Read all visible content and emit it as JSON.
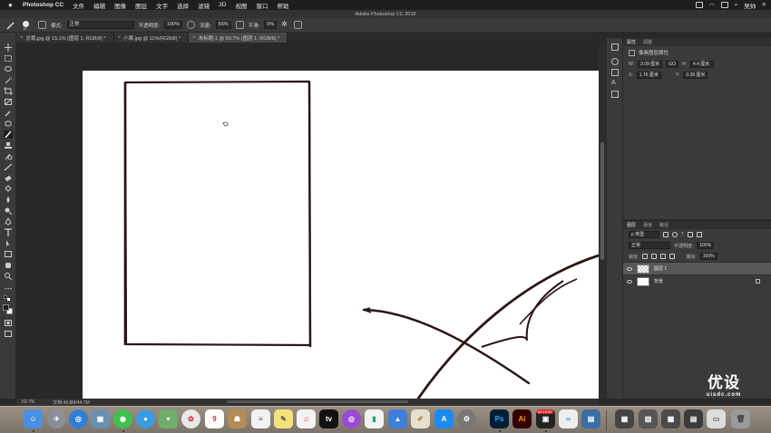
{
  "menubar": {
    "app_name": "Photoshop CC",
    "items": [
      "文件",
      "编辑",
      "图像",
      "图层",
      "文字",
      "选择",
      "滤镜",
      "3D",
      "视图",
      "窗口",
      "帮助"
    ],
    "user": "吴帅"
  },
  "window": {
    "title": "Adobe Photoshop CC 2018"
  },
  "options": {
    "mode_label": "模式:",
    "mode_value": "正常",
    "opacity_label": "不透明度:",
    "opacity_value": "100%",
    "flow_label": "流量:",
    "flow_value": "65%",
    "smoothing_label": "平滑:",
    "smoothing_value": "0%",
    "brush_size": "16"
  },
  "tabs": [
    {
      "label": "总裁.jpg @ 15.1% (图层 1, RGB/8) *"
    },
    {
      "label": "小果.jpg @ 11%(RGB/8) *"
    },
    {
      "label": "未标题-1 @ 50.7% (图层 1, RGB/8) *"
    }
  ],
  "status": {
    "zoom": "50.7%",
    "doc": "文档:49.8M/44.7M"
  },
  "properties": {
    "tab_properties": "属性",
    "tab_adjust": "调整",
    "subtitle": "像素图层属性",
    "w_label": "W:",
    "w_value": "3.09 厘米",
    "go_label": "GO",
    "h_label": "H:",
    "h_value": "4.4 厘米",
    "x_label": "X:",
    "x_value": "1.76 厘米",
    "y_label": "Y:",
    "y_value": "0.38 厘米"
  },
  "layers": {
    "tab_layers": "图层",
    "tab_channels": "通道",
    "tab_paths": "路径",
    "kind_label": "ρ 类型",
    "blend_mode": "正常",
    "opacity_label": "不透明度:",
    "opacity_value": "100%",
    "lock_label": "锁定:",
    "fill_label": "填充:",
    "fill_value": "100%",
    "items": [
      {
        "name": "图层 1"
      },
      {
        "name": "背景"
      }
    ]
  },
  "watermark": {
    "title": "优设",
    "url": "uisdc.com"
  },
  "dock": {
    "calendar_day": "9",
    "ps_label": "Ps",
    "ai_label": "Ai",
    "recording_time": "00:16:59"
  },
  "colors": {
    "ui_bg": "#3a3a3a",
    "canvas_bg": "#282828",
    "stroke": "#2a1414",
    "ps_blue": "#31a8ff",
    "ai_orange": "#ff9a00"
  }
}
